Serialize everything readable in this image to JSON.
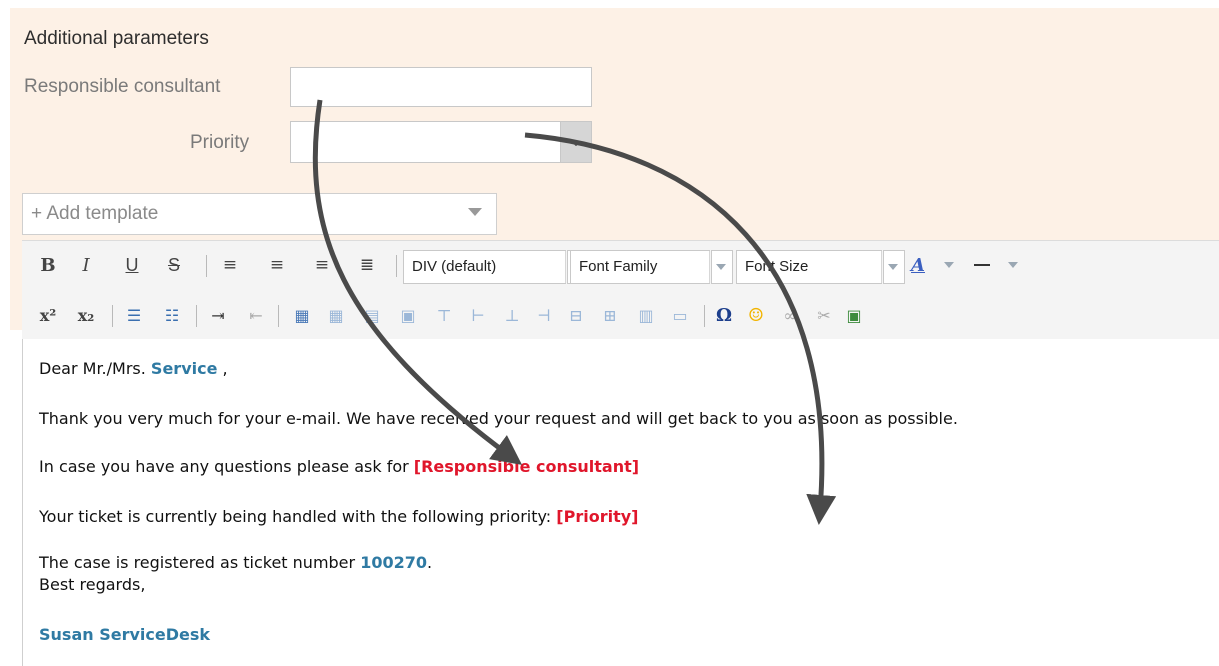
{
  "params": {
    "title": "Additional parameters",
    "consultant_label": "Responsible consultant",
    "consultant_value": "",
    "priority_label": "Priority",
    "priority_value": ""
  },
  "template": {
    "placeholder": "+ Add template"
  },
  "toolbar": {
    "row1": [
      "bold-icon",
      "italic-icon",
      "underline-icon",
      "strikethrough-icon",
      "align-left-icon",
      "align-center-icon",
      "align-right-icon",
      "align-justify-icon"
    ],
    "format_select": "DIV (default)",
    "font_family_select": "Font Family",
    "font_size_select": "Font Size",
    "row2": [
      "superscript-icon",
      "subscript-icon",
      "bullet-list-icon",
      "numbered-list-icon",
      "indent-icon",
      "outdent-icon",
      "table-icon",
      "special-character-icon",
      "emoticon-icon",
      "link-icon",
      "unlink-icon",
      "image-icon"
    ],
    "colors": {
      "text_color": "#3b5fc0",
      "highlight": "#333333"
    }
  },
  "editor": {
    "greeting_prefix": "Dear Mr./Mrs. ",
    "greeting_name": "Service",
    "greeting_suffix": " ,",
    "thanks": "Thank you very much for your e-mail. We have received your request and will get back to you as soon as possible.",
    "ask_prefix": "In case you have any questions please ask for ",
    "ask_placeholder": "[Responsible consultant]",
    "priority_prefix": "Your ticket is currently being handled with the following priority: ",
    "priority_placeholder": "[Priority]",
    "ticket_prefix": "The case is registered as ticket number ",
    "ticket_number": "100270",
    "ticket_suffix": ".",
    "regards": "Best regards,",
    "signature": "Susan ServiceDesk"
  },
  "colors": {
    "panel_bg": "#fdf1e6",
    "link_blue": "#2f7aa3",
    "placeholder_red": "#e0162b",
    "arrow": "#4a4a4a"
  }
}
